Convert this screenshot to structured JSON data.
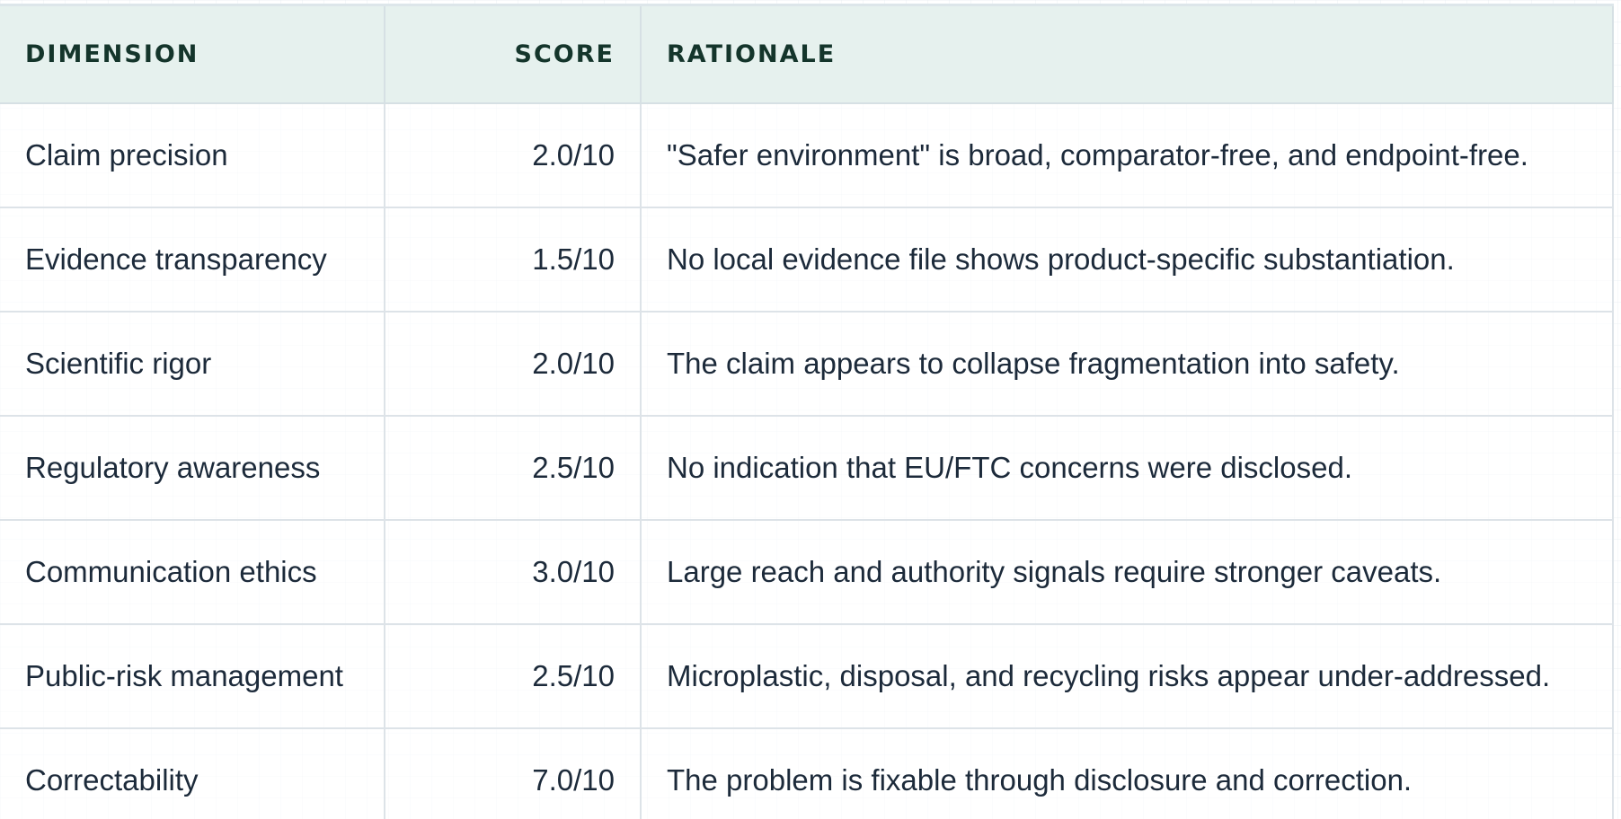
{
  "table": {
    "headers": {
      "dimension": "DIMENSION",
      "score": "SCORE",
      "rationale": "RATIONALE"
    },
    "rows": [
      {
        "dimension": "Claim precision",
        "score": "2.0/10",
        "rationale": "\"Safer environment\" is broad, comparator-free, and endpoint-free."
      },
      {
        "dimension": "Evidence transparency",
        "score": "1.5/10",
        "rationale": "No local evidence file shows product-specific substantiation."
      },
      {
        "dimension": "Scientific rigor",
        "score": "2.0/10",
        "rationale": "The claim appears to collapse fragmentation into safety."
      },
      {
        "dimension": "Regulatory awareness",
        "score": "2.5/10",
        "rationale": "No indication that EU/FTC concerns were disclosed."
      },
      {
        "dimension": "Communication ethics",
        "score": "3.0/10",
        "rationale": "Large reach and authority signals require stronger caveats."
      },
      {
        "dimension": "Public-risk management",
        "score": "2.5/10",
        "rationale": "Microplastic, disposal, and recycling risks appear under-addressed."
      },
      {
        "dimension": "Correctability",
        "score": "7.0/10",
        "rationale": "The problem is fixable through disclosure and correction."
      }
    ]
  },
  "colors": {
    "header_bg": "#e6f1ee",
    "header_text": "#14352b",
    "body_text": "#1c2a3a",
    "border": "#dde3e8"
  }
}
